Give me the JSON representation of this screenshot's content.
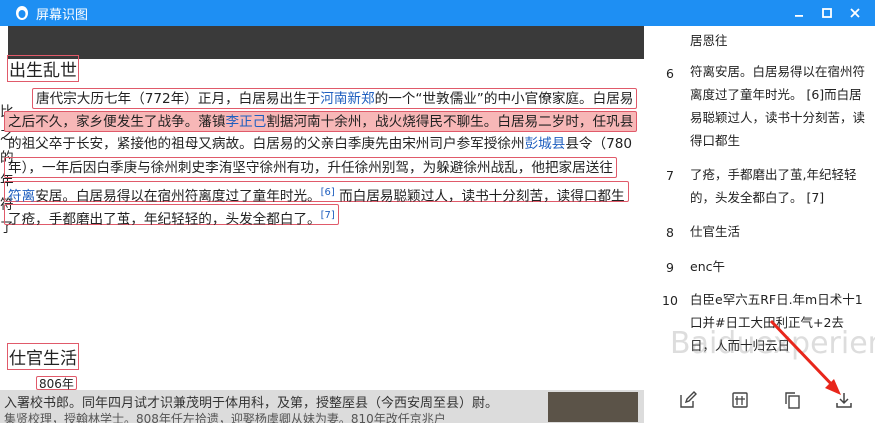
{
  "app": {
    "title": "屏幕识图"
  },
  "window": {
    "minimize": "━",
    "maximize": "☐",
    "close": "✕"
  },
  "doc": {
    "heading1": "出生乱世",
    "heading2": "仕官生活",
    "lines": [
      {
        "parts": [
          {
            "t": "唐代宗大历七年（772年）正月，白居易出生于"
          },
          {
            "t": "河南新郑",
            "link": true
          },
          {
            "t": "的一个“世敦儒业”的中小官僚家庭。白居易"
          }
        ]
      },
      {
        "parts": [
          {
            "t": "之后不久，家乡便发生了战争。藩镇"
          },
          {
            "t": "李正己",
            "link": true
          },
          {
            "t": "割据河南十余州，战火烧得民不聊生。白居易二岁时，任巩县"
          }
        ]
      },
      {
        "parts": [
          {
            "t": "的祖父卒于长安，紧接他的祖母又病故。白居易的父亲白季庚先由宋州司户参军授徐州"
          },
          {
            "t": "彭城县",
            "link": true
          },
          {
            "t": "县令（780"
          }
        ]
      },
      {
        "parts": [
          {
            "t": "年），一年后因白季庚与徐州刺史李洧坚守徐州有功，升任徐州别驾，为躲避徐州战乱，他把家居送往"
          }
        ]
      },
      {
        "parts": [
          {
            "t": "符离",
            "link": true
          },
          {
            "t": "安居。白居易得以在宿州符离度过了童年时光。"
          },
          {
            "t": "[6]",
            "sup": true
          },
          {
            "t": " 而白居易聪颖过人，读书十分刻苦，读得口都生"
          }
        ]
      },
      {
        "parts": [
          {
            "t": "了疮，手都磨出了茧，年纪轻轻的，头发全都白了。"
          },
          {
            "t": "[7]",
            "sup": true
          }
        ]
      }
    ],
    "margin_chars": [
      "比",
      "之",
      "的",
      "年",
      "符",
      "了"
    ],
    "bottom_line1": "入署校书郎。同年四月试才识兼茂明于体用科，及第，授整厔县（今西安周至县）尉。",
    "bottom_line2": "集贤校理，授翰林学士。808年任左拾遗，迎娶杨虞卿从妹为妻。810年改任京兆户",
    "partial_box": "806年"
  },
  "ocr": {
    "partial_top": "居恩往",
    "items": [
      {
        "num": "6",
        "text": "符离安居。白居易得以在宿州符离度过了童年时光。 [6]而白居易聪颖过人，读书十分刻苦，读得口都生"
      },
      {
        "num": "7",
        "text": "了疮，手都磨出了茧,年纪轻轻的，头发全都白了。 [7]"
      },
      {
        "num": "8",
        "text": "仕官生活"
      },
      {
        "num": "9",
        "text": "enc午"
      },
      {
        "num": "10",
        "text": "白臣e罕六五RF日.年m日术十1口并#日工大田利正气+2去日，人而十归云日"
      }
    ],
    "watermark": "Baiduexperience"
  },
  "footer": {
    "icons": [
      "edit-icon",
      "translate-icon",
      "copy-icon",
      "download-icon"
    ]
  },
  "colors": {
    "titlebar": "#1e8ff3",
    "highlight": "#f7b7b7",
    "box": "#e05a6a",
    "arrow": "#e8261b"
  }
}
